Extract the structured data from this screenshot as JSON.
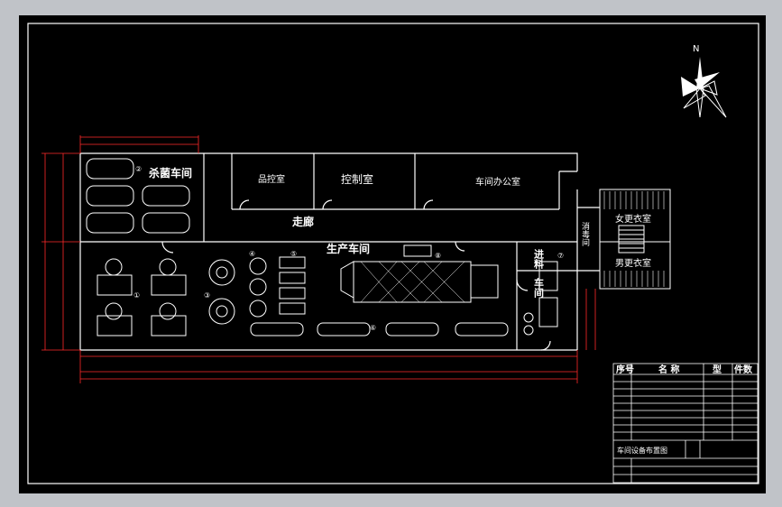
{
  "drawing": {
    "north_label": "N",
    "rooms": {
      "sterilize": "杀菌车间",
      "inspection": "品控室",
      "control": "控制室",
      "office": "车间办公室",
      "corridor": "走廊",
      "production": "生产车间",
      "disinfect": "消毒间",
      "female_locker": "女更衣室",
      "male_locker": "男更衣室",
      "material_col1": "进料",
      "material_col2": "车间"
    },
    "callouts": [
      "①",
      "②",
      "③",
      "④",
      "⑤",
      "⑥",
      "⑦",
      "⑧",
      "⑨"
    ]
  },
  "title_block": {
    "headers": {
      "no": "序号",
      "name": "名 称",
      "model": "型",
      "qty": "件数"
    },
    "drawing_name": "车间设备布置图"
  },
  "colors": {
    "background": "#000000",
    "lines": "#ffffff",
    "dims": "#ff2a2a",
    "frame": "#c0c3c8"
  }
}
